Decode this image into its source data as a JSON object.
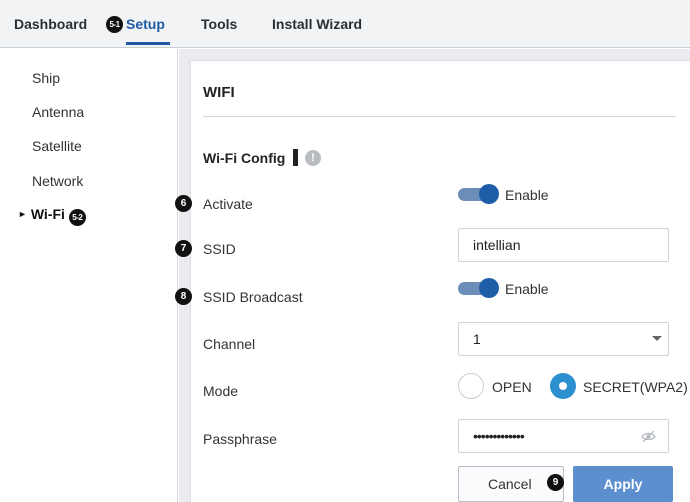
{
  "nav": {
    "dashboard": "Dashboard",
    "badge_setup": "5-1",
    "setup": "Setup",
    "tools": "Tools",
    "install_wizard": "Install Wizard"
  },
  "sidebar": {
    "items": [
      {
        "label": "Ship"
      },
      {
        "label": "Antenna"
      },
      {
        "label": "Satellite"
      },
      {
        "label": "Network"
      },
      {
        "label": "Wi-Fi",
        "active": true,
        "marker": "►",
        "badge": "5-2"
      }
    ]
  },
  "panel": {
    "title": "WIFI",
    "section_title": "Wi-Fi Config",
    "info_glyph": "!"
  },
  "form": {
    "activate": {
      "badge": "6",
      "label": "Activate",
      "toggle_text": "Enable",
      "on": true
    },
    "ssid": {
      "badge": "7",
      "label": "SSID",
      "value": "intellian"
    },
    "ssid_broadcast": {
      "badge": "8",
      "label": "SSID Broadcast",
      "toggle_text": "Enable",
      "on": true
    },
    "channel": {
      "label": "Channel",
      "value": "1"
    },
    "mode": {
      "label": "Mode",
      "options": [
        "OPEN",
        "SECRET(WPA2)"
      ],
      "selected": "SECRET(WPA2)"
    },
    "passphrase": {
      "label": "Passphrase",
      "value": "•••••••••••••"
    }
  },
  "buttons": {
    "cancel": "Cancel",
    "badge": "9",
    "apply": "Apply"
  },
  "colors": {
    "accent": "#1f5aa5",
    "toggle_on": "#1e5ea8",
    "radio_checked": "#2c8fd0",
    "apply_button": "#5c8fce"
  }
}
